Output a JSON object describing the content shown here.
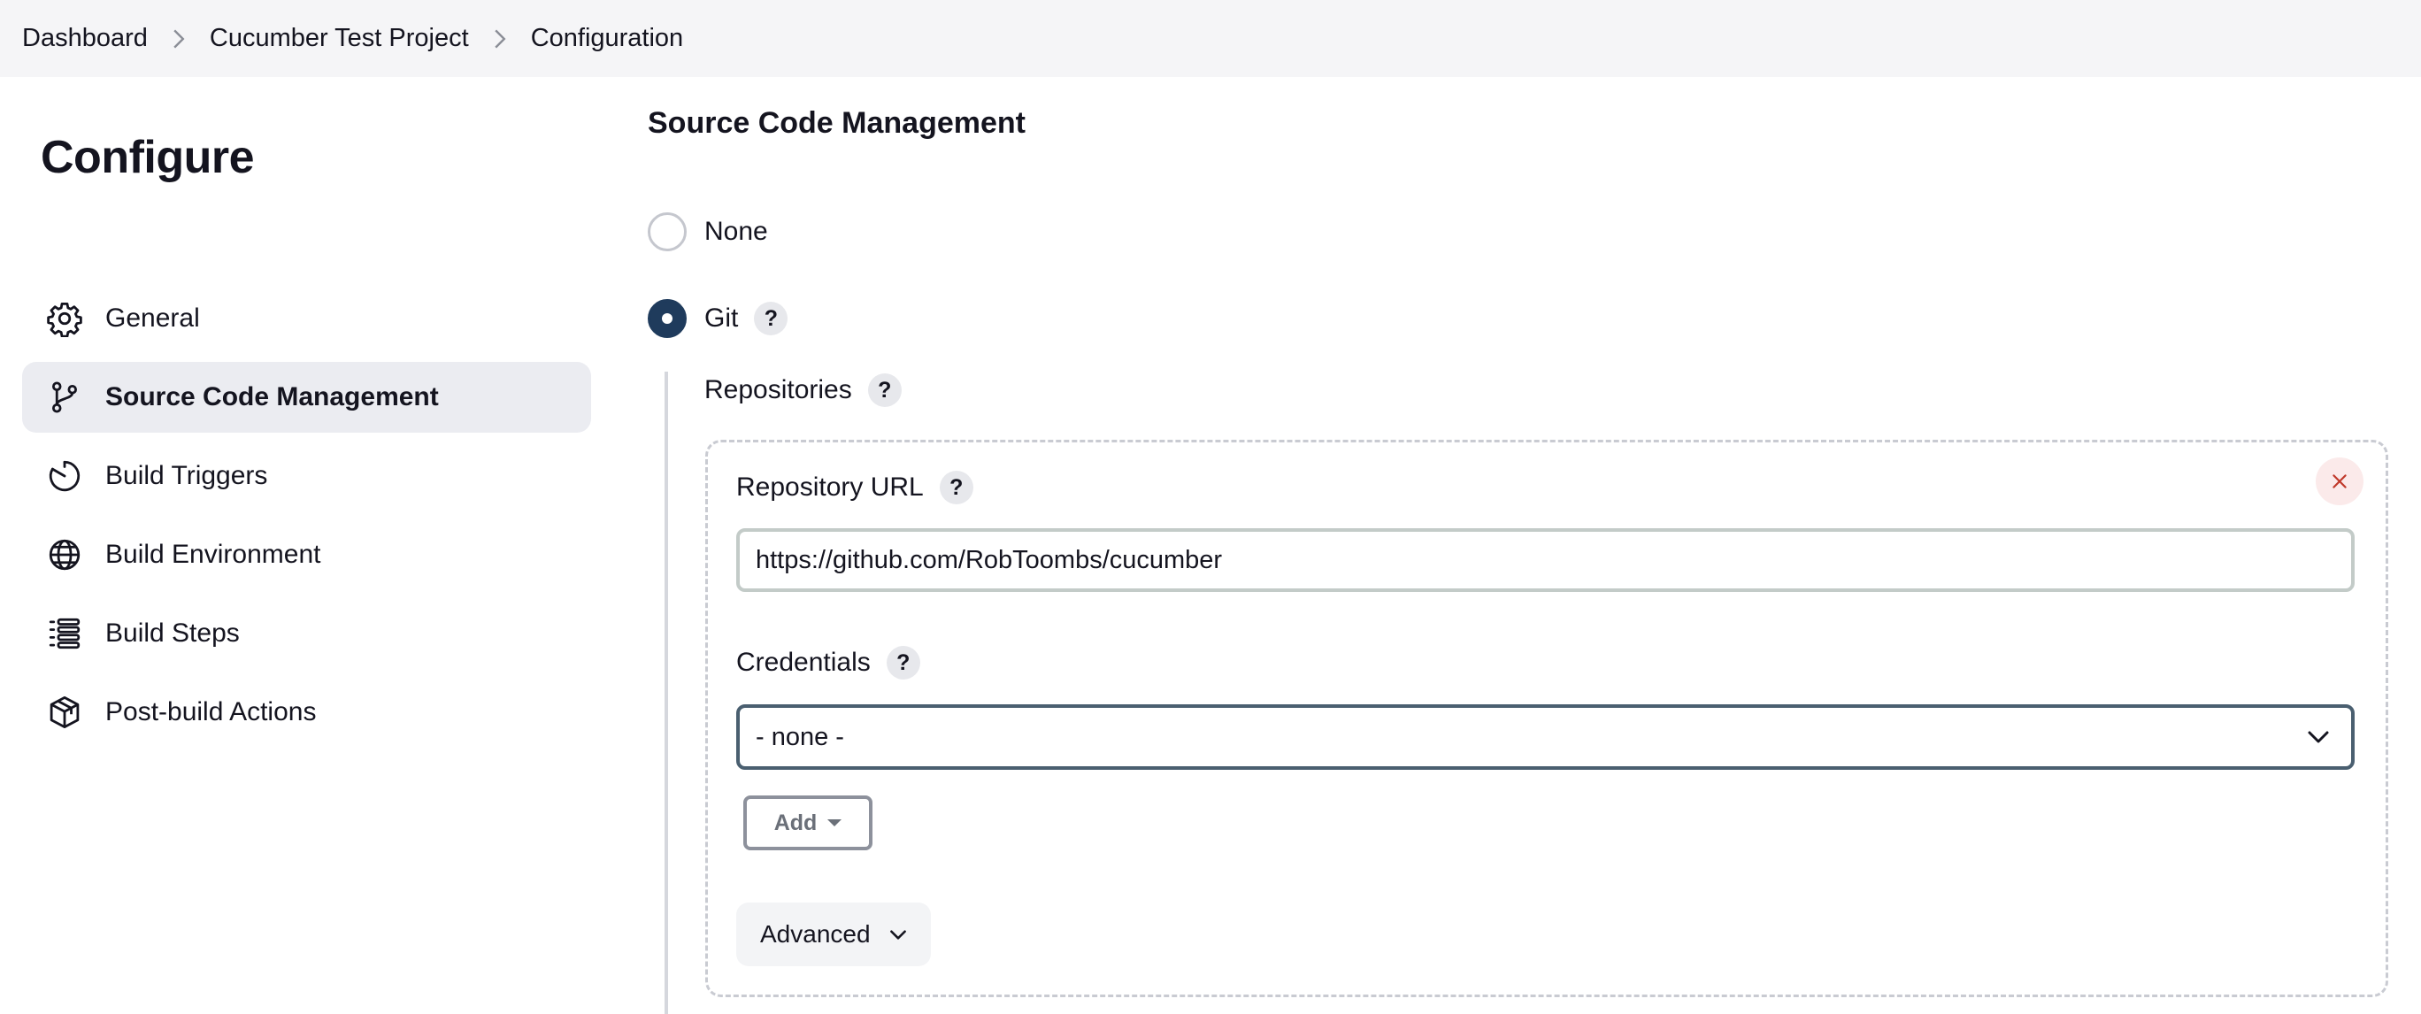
{
  "breadcrumb": {
    "items": [
      "Dashboard",
      "Cucumber Test Project",
      "Configuration"
    ]
  },
  "sidebar": {
    "title": "Configure",
    "items": [
      {
        "label": "General",
        "icon": "gear-icon"
      },
      {
        "label": "Source Code Management",
        "icon": "git-branch-icon",
        "active": true
      },
      {
        "label": "Build Triggers",
        "icon": "timer-icon"
      },
      {
        "label": "Build Environment",
        "icon": "globe-icon"
      },
      {
        "label": "Build Steps",
        "icon": "list-icon"
      },
      {
        "label": "Post-build Actions",
        "icon": "package-icon"
      }
    ]
  },
  "main": {
    "section_title": "Source Code Management",
    "scm_options": [
      {
        "label": "None",
        "selected": false
      },
      {
        "label": "Git",
        "selected": true
      }
    ],
    "help_symbol": "?",
    "repositories_label": "Repositories",
    "repository_url_label": "Repository URL",
    "repository_url_value": "https://github.com/RobToombs/cucumber",
    "credentials_label": "Credentials",
    "credentials_selected": "- none -",
    "add_button_label": "Add",
    "advanced_button_label": "Advanced"
  },
  "colors": {
    "accent": "#1f3b5c",
    "active_sidebar_bg": "#ebecf1",
    "topbar_bg": "#f5f5f7",
    "close_bg": "#fbeaea",
    "close_fg": "#c0392b"
  }
}
